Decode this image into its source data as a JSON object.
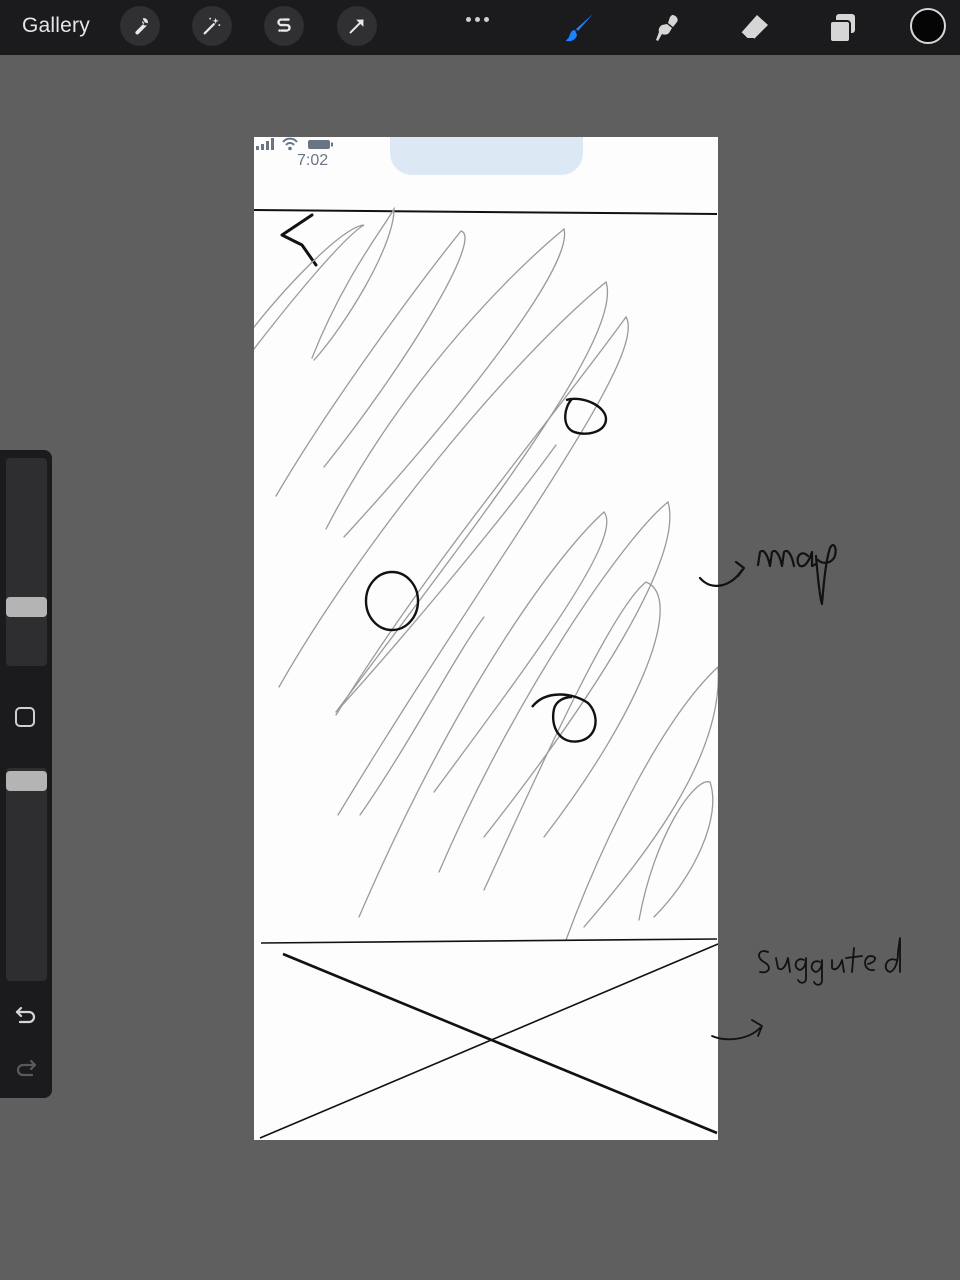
{
  "toolbar": {
    "gallery_label": "Gallery",
    "left_tools": [
      {
        "name": "actions",
        "icon": "wrench-icon"
      },
      {
        "name": "adjustments",
        "icon": "magic-wand-icon"
      },
      {
        "name": "selection",
        "icon": "selection-s-icon"
      },
      {
        "name": "transform",
        "icon": "arrow-cursor-icon"
      }
    ],
    "more_icon": "more-dots-icon",
    "right_tools": [
      {
        "name": "brush",
        "icon": "brush-icon",
        "active": true,
        "color": "#1a82ff"
      },
      {
        "name": "smudge",
        "icon": "smudge-icon",
        "active": false
      },
      {
        "name": "eraser",
        "icon": "eraser-icon",
        "active": false
      },
      {
        "name": "layers",
        "icon": "layers-icon",
        "active": false
      }
    ],
    "current_color": "#050505"
  },
  "sidebar": {
    "brush_size_level": 0.28,
    "brush_opacity_level": 0.95,
    "modify_icon": "square-icon",
    "undo_icon": "undo-icon",
    "redo_icon": "redo-icon"
  },
  "canvas": {
    "status_bar": {
      "time": "7:02",
      "icons": [
        "signal-icon",
        "wifi-icon",
        "battery-icon"
      ]
    }
  }
}
